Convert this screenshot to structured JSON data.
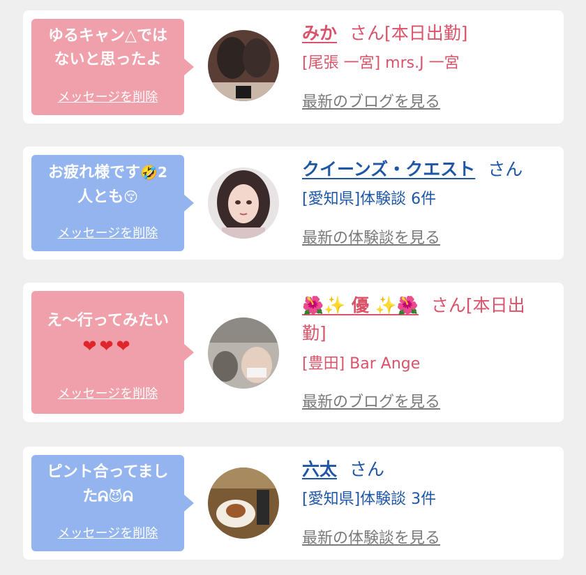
{
  "cards": [
    {
      "bubble_color": "#f0a0ab",
      "message_line1": "ゆるキャン△では",
      "message_line2": "ないと思ったよ",
      "delete_label": "メッセージを削除",
      "name": "みか",
      "suffix": "さん[本日出勤]",
      "sub": "[尾張 一宮] mrs.J 一宮",
      "link": "最新のブログを見る",
      "text_color": "#d9536a",
      "avatar": "photo-avatar"
    },
    {
      "bubble_color": "#93b4ee",
      "message_line1": "お疲れ様です",
      "message_line1_emoji": "🤣2",
      "message_line2": "人とも",
      "message_line2_emoji": "😚",
      "delete_label": "メッセージを削除",
      "name": "クイーンズ・クエスト",
      "suffix": "さん",
      "sub": "[愛知県]体験談 6件",
      "link": "最新の体験談を見る",
      "text_color": "#1f57a6",
      "avatar": "anime-girl-avatar"
    },
    {
      "bubble_color": "#f0a0ab",
      "message_line1": "え～行ってみたい",
      "message_line2_emoji": "❤❤❤",
      "delete_label": "メッセージを削除",
      "name": "🌺✨ 優 ✨🌺",
      "suffix": "さん[本日出",
      "suffix_line2": "勤]",
      "sub": "[豊田] Bar Ange",
      "link": "最新のブログを見る",
      "text_color": "#d9536a",
      "avatar": "photo-avatar"
    },
    {
      "bubble_color": "#93b4ee",
      "message_line1": "ピント合ってまし",
      "message_line2": "た",
      "message_line2_emoji": "ᕱ😈ᕱ",
      "delete_label": "メッセージを削除",
      "name": "六太",
      "suffix": "さん",
      "sub": "[愛知県]体験談 3件",
      "link": "最新の体験談を見る",
      "text_color": "#1f57a6",
      "avatar": "food-photo-avatar"
    }
  ]
}
